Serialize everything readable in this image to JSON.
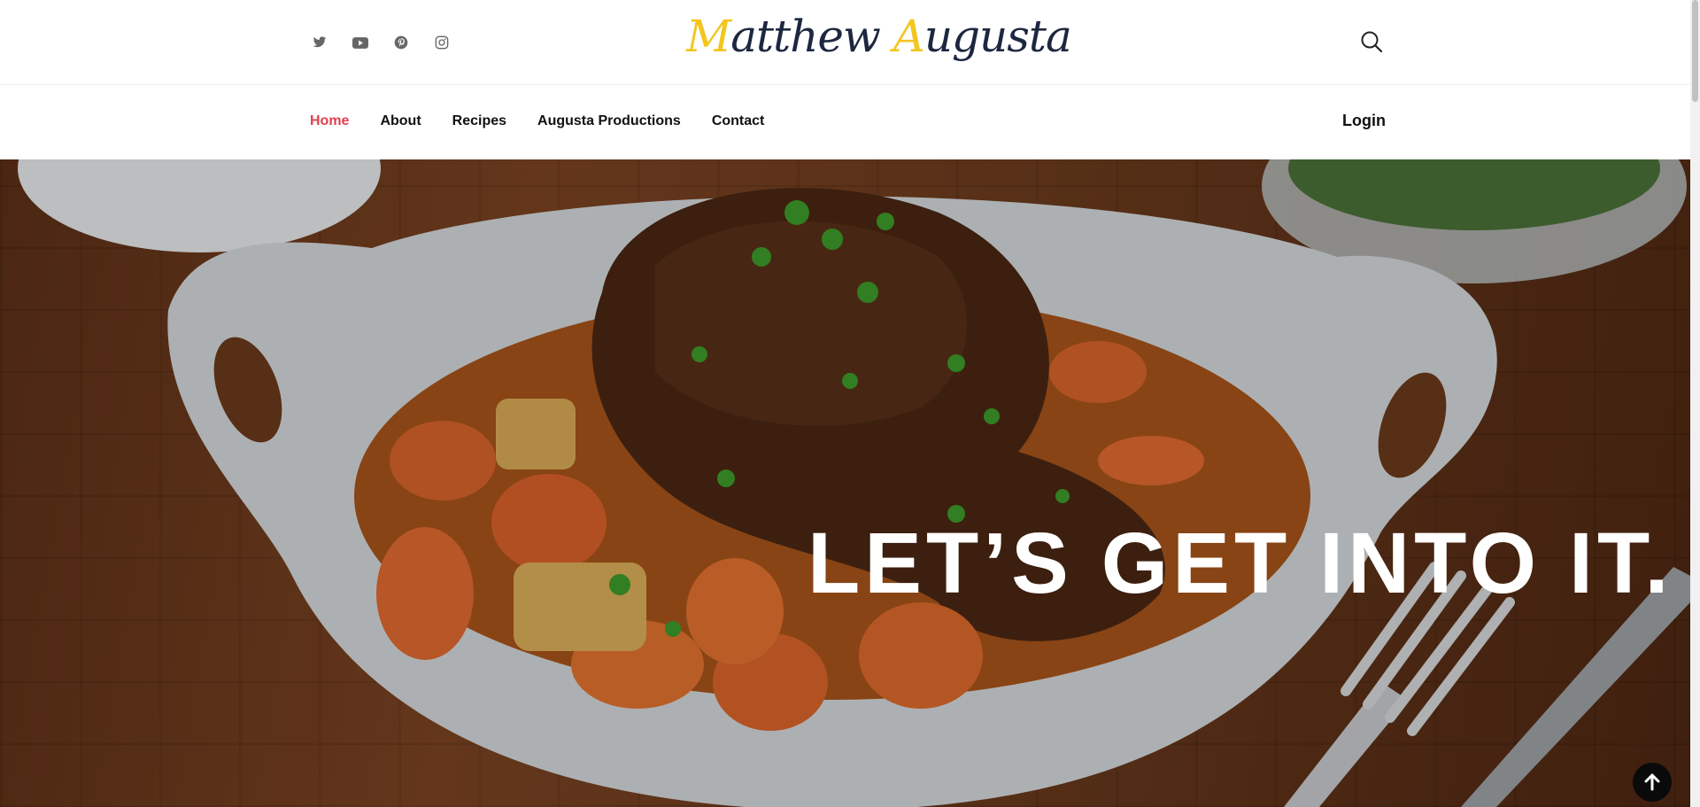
{
  "header": {
    "logo_text": "Matthew Augusta",
    "social_icons": [
      "twitter-icon",
      "youtube-icon",
      "pinterest-icon",
      "instagram-icon"
    ],
    "search_icon": "search-icon"
  },
  "nav": {
    "items": [
      {
        "label": "Home",
        "active": true
      },
      {
        "label": "About",
        "active": false
      },
      {
        "label": "Recipes",
        "active": false
      },
      {
        "label": "Augusta Productions",
        "active": false
      },
      {
        "label": "Contact",
        "active": false
      }
    ],
    "login_label": "Login"
  },
  "hero": {
    "headline": "LET’S GET INTO IT."
  },
  "colors": {
    "accent": "#e0414f",
    "logo_navy": "#1d2741",
    "logo_gold": "#f2c61f"
  }
}
